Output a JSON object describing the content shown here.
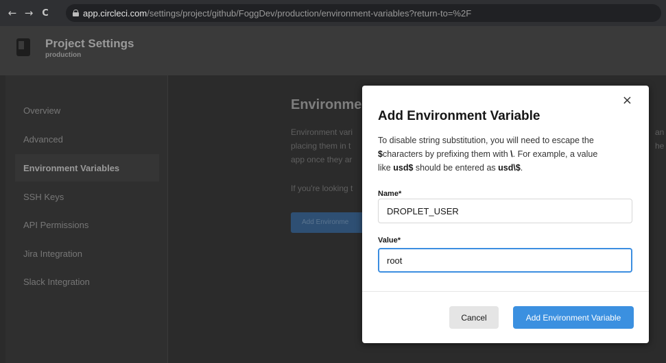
{
  "browser": {
    "back_icon": "←",
    "forward_icon": "→",
    "reload_icon": "C",
    "url_host": "app.circleci.com",
    "url_path": "/settings/project/github/FoggDev/production/environment-variables?return-to=%2F"
  },
  "header": {
    "title": "Project Settings",
    "subtitle": "production"
  },
  "sidebar": {
    "items": [
      {
        "label": "Overview"
      },
      {
        "label": "Advanced"
      },
      {
        "label": "Environment Variables"
      },
      {
        "label": "SSH Keys"
      },
      {
        "label": "API Permissions"
      },
      {
        "label": "Jira Integration"
      },
      {
        "label": "Slack Integration"
      }
    ],
    "active_index": 2
  },
  "main": {
    "heading": "Environmen",
    "text_lines": [
      "Environment vari",
      "placing them in t",
      "app once they ar"
    ],
    "help_text": "If you're looking t",
    "add_button_label": "Add Environme",
    "right_fragments": [
      "an",
      "he"
    ]
  },
  "modal": {
    "close_icon": "×",
    "title": "Add Environment Variable",
    "desc_1": "To disable string substitution, you will need to escape the",
    "desc_2a": "$",
    "desc_2b": "characters by prefixing them with ",
    "desc_2c": "\\",
    "desc_2d": ". For example, a value",
    "desc_3a": "like ",
    "desc_3b": "usd$",
    "desc_3c": " should be entered as ",
    "desc_3d": "usd\\$",
    "desc_3e": ".",
    "name_label": "Name*",
    "name_value": "DROPLET_USER",
    "value_label": "Value*",
    "value_value": "root",
    "cancel_label": "Cancel",
    "submit_label": "Add Environment Variable"
  },
  "colors": {
    "accent": "#3b90e0",
    "focus_border": "#3b8de0"
  }
}
